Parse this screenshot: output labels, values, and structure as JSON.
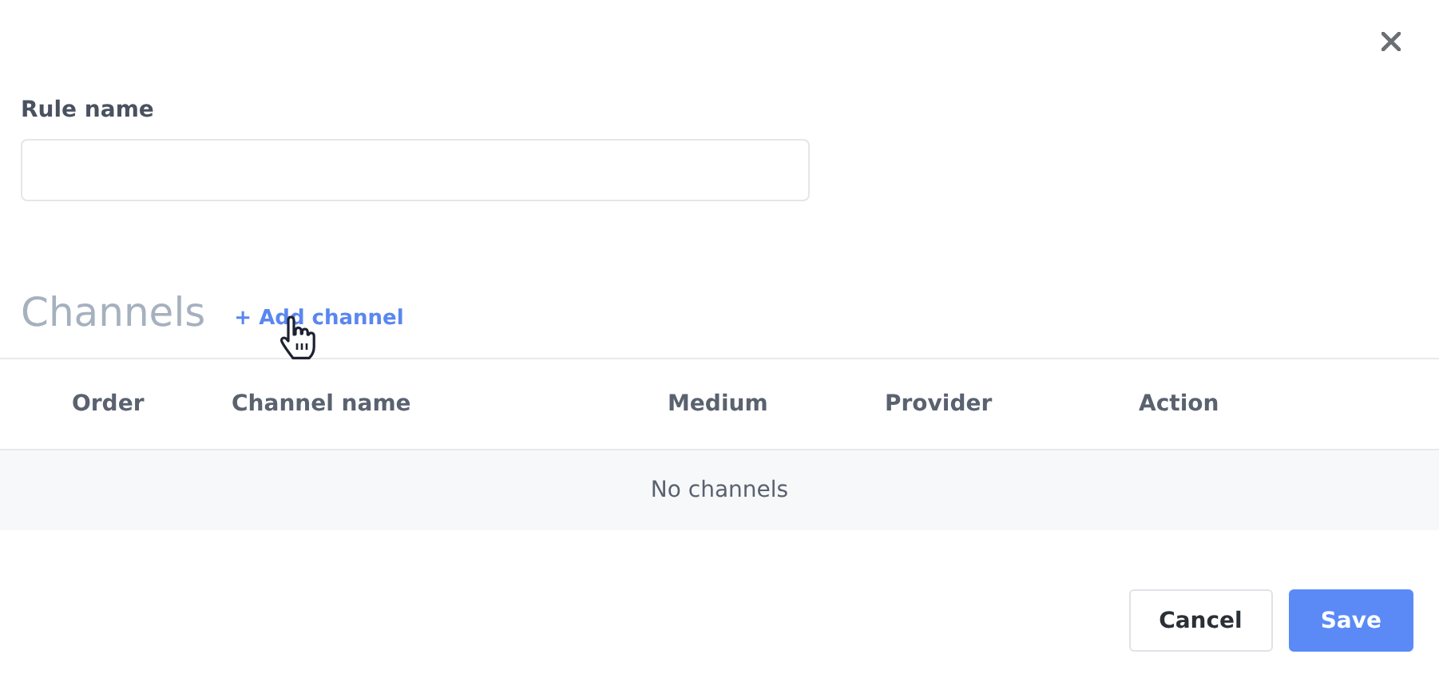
{
  "rule_name": {
    "label": "Rule name"
  },
  "channels": {
    "title": "Channels",
    "add_link": "+ Add channel"
  },
  "table": {
    "columns": [
      "Order",
      "Channel name",
      "Medium",
      "Provider",
      "Action"
    ],
    "empty_text": "No channels"
  },
  "buttons": [
    {
      "kind": "secondary",
      "label": "Cancel"
    },
    {
      "kind": "primary",
      "label": "Save"
    }
  ]
}
